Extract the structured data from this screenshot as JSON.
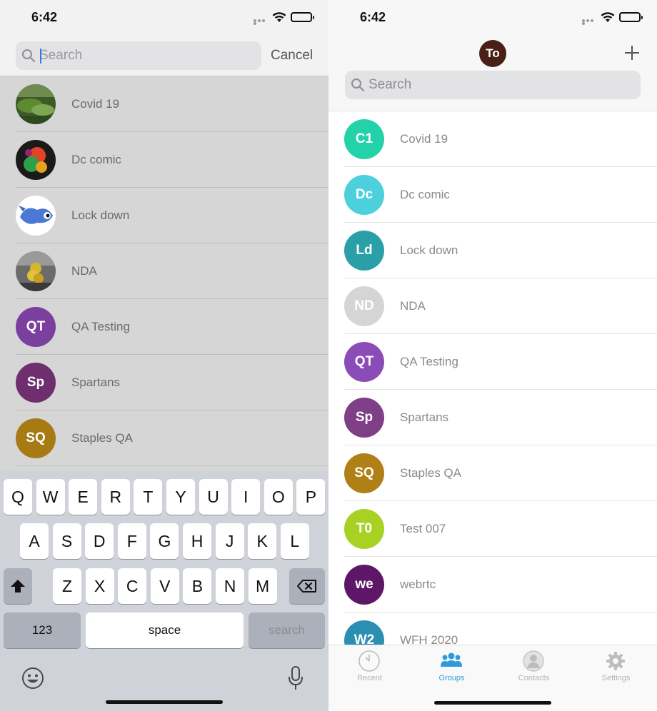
{
  "status_bar": {
    "time": "6:42"
  },
  "left": {
    "search": {
      "placeholder": "Search",
      "value": ""
    },
    "cancel_label": "Cancel",
    "groups": [
      {
        "name": "Covid 19",
        "avatar_type": "photo",
        "photo_hint": "green-landscape"
      },
      {
        "name": "Dc comic",
        "avatar_type": "photo",
        "photo_hint": "colorful-art"
      },
      {
        "name": "Lock down",
        "avatar_type": "photo",
        "photo_hint": "blue-cartoon-bird"
      },
      {
        "name": "NDA",
        "avatar_type": "photo",
        "photo_hint": "flowers"
      },
      {
        "name": "QA Testing",
        "avatar_type": "initials",
        "initials": "QT",
        "color": "#7b3fa0"
      },
      {
        "name": "Spartans",
        "avatar_type": "initials",
        "initials": "Sp",
        "color": "#6f2f6e"
      },
      {
        "name": "Staples QA",
        "avatar_type": "initials",
        "initials": "SQ",
        "color": "#a77a14"
      }
    ],
    "keyboard": {
      "row1": [
        "Q",
        "W",
        "E",
        "R",
        "T",
        "Y",
        "U",
        "I",
        "O",
        "P"
      ],
      "row2": [
        "A",
        "S",
        "D",
        "F",
        "G",
        "H",
        "J",
        "K",
        "L"
      ],
      "row3": [
        "Z",
        "X",
        "C",
        "V",
        "B",
        "N",
        "M"
      ],
      "numbers_key": "123",
      "space_key": "space",
      "search_key": "search"
    }
  },
  "right": {
    "profile_initials": "To",
    "search": {
      "placeholder": "Search"
    },
    "groups": [
      {
        "name": "Covid 19",
        "initials": "C1",
        "color": "#23d2a8"
      },
      {
        "name": "Dc comic",
        "initials": "Dc",
        "color": "#4cd0dc"
      },
      {
        "name": "Lock down",
        "initials": "Ld",
        "color": "#2a9fa8"
      },
      {
        "name": "NDA",
        "initials": "ND",
        "color": "#d5d5d5"
      },
      {
        "name": "QA Testing",
        "initials": "QT",
        "color": "#8b4cb8"
      },
      {
        "name": "Spartans",
        "initials": "Sp",
        "color": "#7f3f86"
      },
      {
        "name": "Staples QA",
        "initials": "SQ",
        "color": "#b07f16"
      },
      {
        "name": "Test 007",
        "initials": "T0",
        "color": "#a7d224"
      },
      {
        "name": "webrtc",
        "initials": "we",
        "color": "#5e1767"
      },
      {
        "name": "WFH 2020",
        "initials": "W2",
        "color": "#2a8fb1"
      }
    ],
    "tabs": [
      {
        "label": "Recent",
        "icon": "clock-icon",
        "active": false
      },
      {
        "label": "Groups",
        "icon": "groups-icon",
        "active": true
      },
      {
        "label": "Contacts",
        "icon": "contact-icon",
        "active": false
      },
      {
        "label": "Settings",
        "icon": "gear-icon",
        "active": false
      }
    ],
    "accent_color": "#2f9bdb"
  }
}
